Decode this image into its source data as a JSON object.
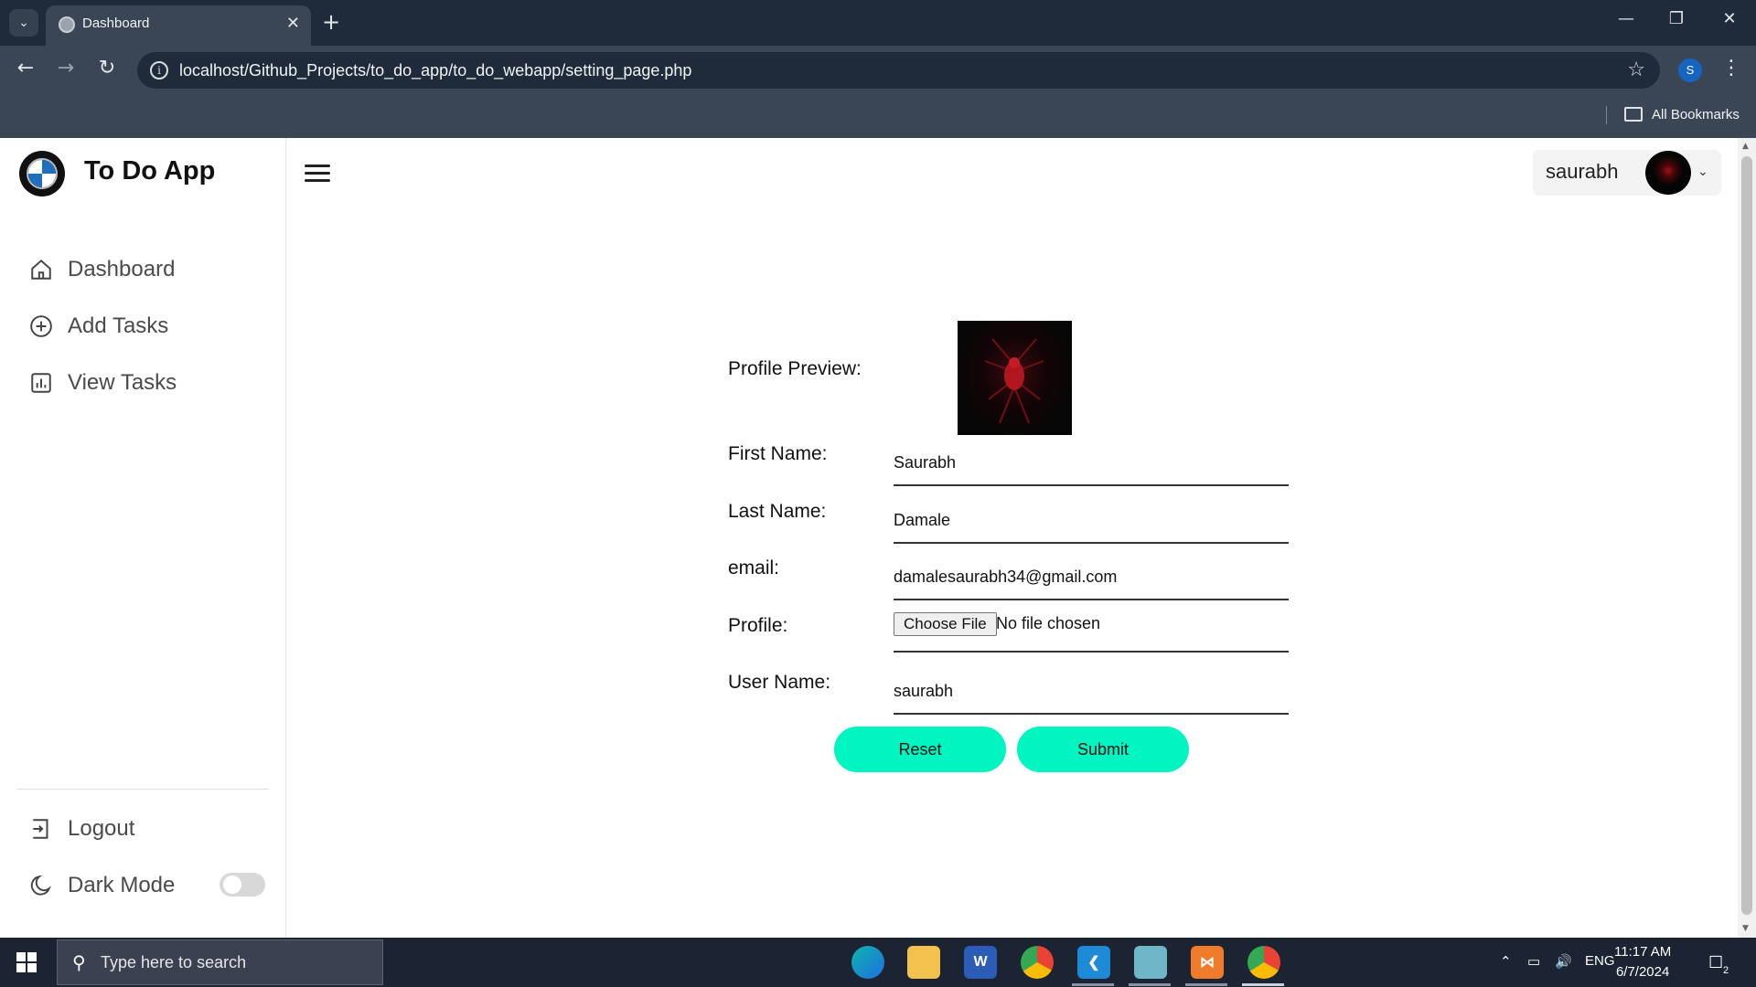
{
  "browser": {
    "tab_title": "Dashboard",
    "url": "localhost/Github_Projects/to_do_app/to_do_webapp/setting_page.php",
    "profile_initial": "S",
    "bookmarks_label": "All Bookmarks"
  },
  "app": {
    "title": "To Do App",
    "menu": [
      {
        "label": "Dashboard",
        "icon": "home-icon"
      },
      {
        "label": "Add Tasks",
        "icon": "plus-circle-icon"
      },
      {
        "label": "View Tasks",
        "icon": "bar-chart-icon"
      }
    ],
    "logout_label": "Logout",
    "dark_mode_label": "Dark Mode",
    "dark_mode_on": false,
    "user": {
      "name": "saurabh"
    }
  },
  "form": {
    "profile_preview_label": "Profile Preview:",
    "first_name_label": "First Name:",
    "first_name_value": "Saurabh",
    "last_name_label": "Last Name:",
    "last_name_value": "Damale",
    "email_label": "email:",
    "email_value": "damalesaurabh34@gmail.com",
    "profile_label": "Profile:",
    "choose_file_label": "Choose File",
    "file_status": "No file chosen",
    "username_label": "User Name:",
    "username_value": "saurabh",
    "reset_label": "Reset",
    "submit_label": "Submit",
    "accent_color": "#00f5c1"
  },
  "taskbar": {
    "search_placeholder": "Type here to search",
    "language": "ENG",
    "time": "11:17 AM",
    "date": "6/7/2024",
    "notification_count": "2"
  }
}
